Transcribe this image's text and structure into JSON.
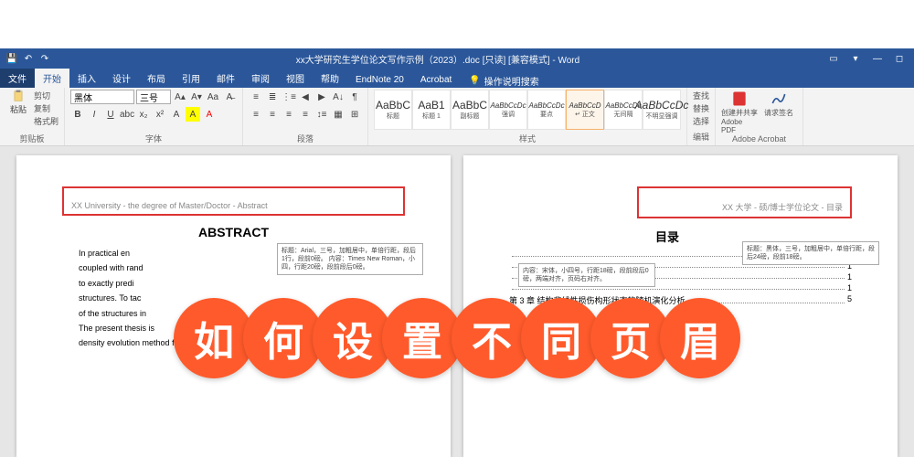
{
  "window": {
    "title": "xx大学研究生学位论文写作示例（2023）.doc [只读] [兼容模式] - Word"
  },
  "tabs": {
    "file": "文件",
    "home": "开始",
    "insert": "插入",
    "design": "设计",
    "layout": "布局",
    "references": "引用",
    "mailings": "邮件",
    "review": "审阅",
    "view": "视图",
    "help": "帮助",
    "endnote": "EndNote 20",
    "acrobat": "Acrobat",
    "tellme": "操作说明搜索"
  },
  "ribbon": {
    "clipboard": {
      "label": "剪贴板",
      "paste": "粘贴",
      "cut": "剪切",
      "copy": "复制",
      "formatpainter": "格式刷"
    },
    "font": {
      "label": "字体",
      "name": "黑体",
      "size": "三号",
      "bold": "B",
      "italic": "I",
      "underline": "U"
    },
    "paragraph": {
      "label": "段落"
    },
    "styles": {
      "label": "样式",
      "items": [
        {
          "preview": "AaBbC",
          "name": "标题"
        },
        {
          "preview": "AaB1",
          "name": "标题 1"
        },
        {
          "preview": "AaBbC",
          "name": "副标题"
        },
        {
          "preview": "AaBbCcDc",
          "name": "强调"
        },
        {
          "preview": "AaBbCcDc",
          "name": "要点"
        },
        {
          "preview": "AaBbCcD",
          "name": "↵ 正文"
        },
        {
          "preview": "AaBbCcDc",
          "name": "无间隔"
        },
        {
          "preview": "AaBbCcDc",
          "name": "不明显强调"
        }
      ]
    },
    "editing": {
      "label": "编辑",
      "find": "查找",
      "replace": "替换",
      "select": "选择"
    },
    "adobe": {
      "label": "Adobe Acrobat",
      "create": "创建并共享",
      "sign": "请求签名",
      "pdf": "Adobe PDF"
    }
  },
  "page_left": {
    "header": "XX University - the degree of Master/Doctor - Abstract",
    "title": "ABSTRACT",
    "callout1": "标题：Arial，三号，加粗居中，单倍行距，段后1行，段前0磅。\n内容：Times New Roman，小四，行距20磅，段前段后0磅。",
    "body": [
      "In practical en",
      "coupled with rand",
      "to exactly predi",
      "structures. To tac",
      "of the structures in",
      "The present thesis is",
      "density evolution method for analysis of nonlinear stochastic structures."
    ]
  },
  "page_right": {
    "header": "XX 大学 - 硕/博士学位论文 - 目录",
    "title": "目录",
    "callout1": "标题：黑体，三号，加粗居中，单倍行距，段后24磅，段前18磅。",
    "callout2": "内容：宋体，小四号，行距18磅，段前段后0磅，两端对齐，页码右对齐。",
    "toc": [
      {
        "text": "",
        "page": "1"
      },
      {
        "text": "",
        "page": "1"
      },
      {
        "text": "",
        "page": "1"
      },
      {
        "text": "",
        "page": "1"
      },
      {
        "text": "第 3 章  结构非线性损伤构形状态的随机演化分析",
        "page": "5"
      }
    ]
  },
  "overlay": {
    "chars": [
      "如",
      "何",
      "设",
      "置",
      "不",
      "同",
      "页",
      "眉"
    ]
  }
}
